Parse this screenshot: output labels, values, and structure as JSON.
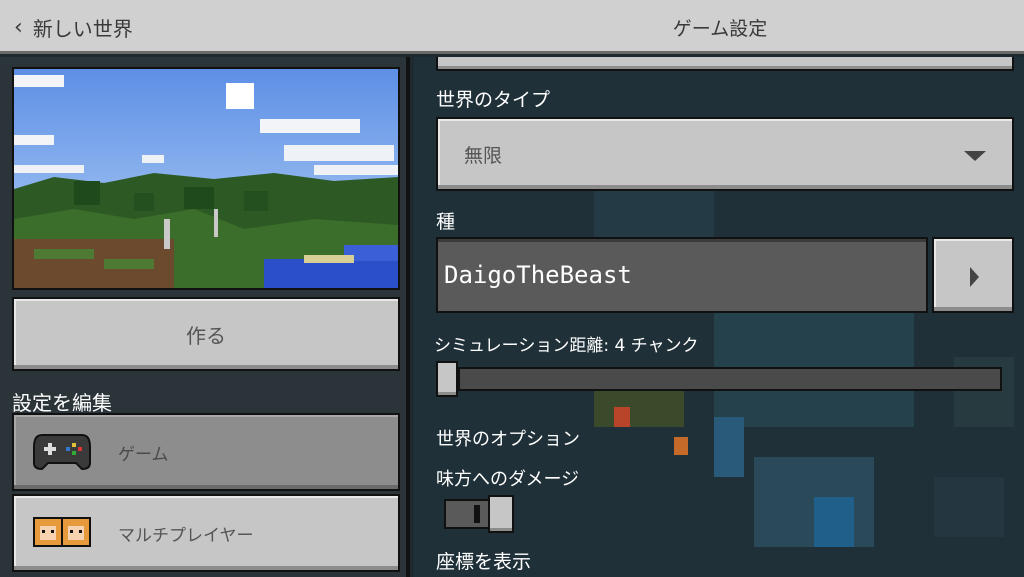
{
  "header": {
    "back_label": "新しい世界",
    "title": "ゲーム設定"
  },
  "left": {
    "create_label": "作る",
    "section_label": "設定を編集",
    "nav": [
      {
        "label": "ゲーム",
        "icon": "controller-icon",
        "selected": true
      },
      {
        "label": "マルチプレイヤー",
        "icon": "players-icon",
        "selected": false
      }
    ]
  },
  "right": {
    "world_type_label": "世界のタイプ",
    "world_type_value": "無限",
    "seed_label": "種",
    "seed_value": "DaigoTheBeast",
    "sim_distance_label": "シミュレーション距離: 4 チャンク",
    "sim_distance_value": 4,
    "world_options_label": "世界のオプション",
    "friendly_fire_label": "味方へのダメージ",
    "friendly_fire_on": true,
    "coords_label": "座標を表示"
  },
  "colors": {
    "button_gray": "#c6c6c6",
    "panel_dark": "#2a3439",
    "selected_gray": "#8d8d8d"
  }
}
